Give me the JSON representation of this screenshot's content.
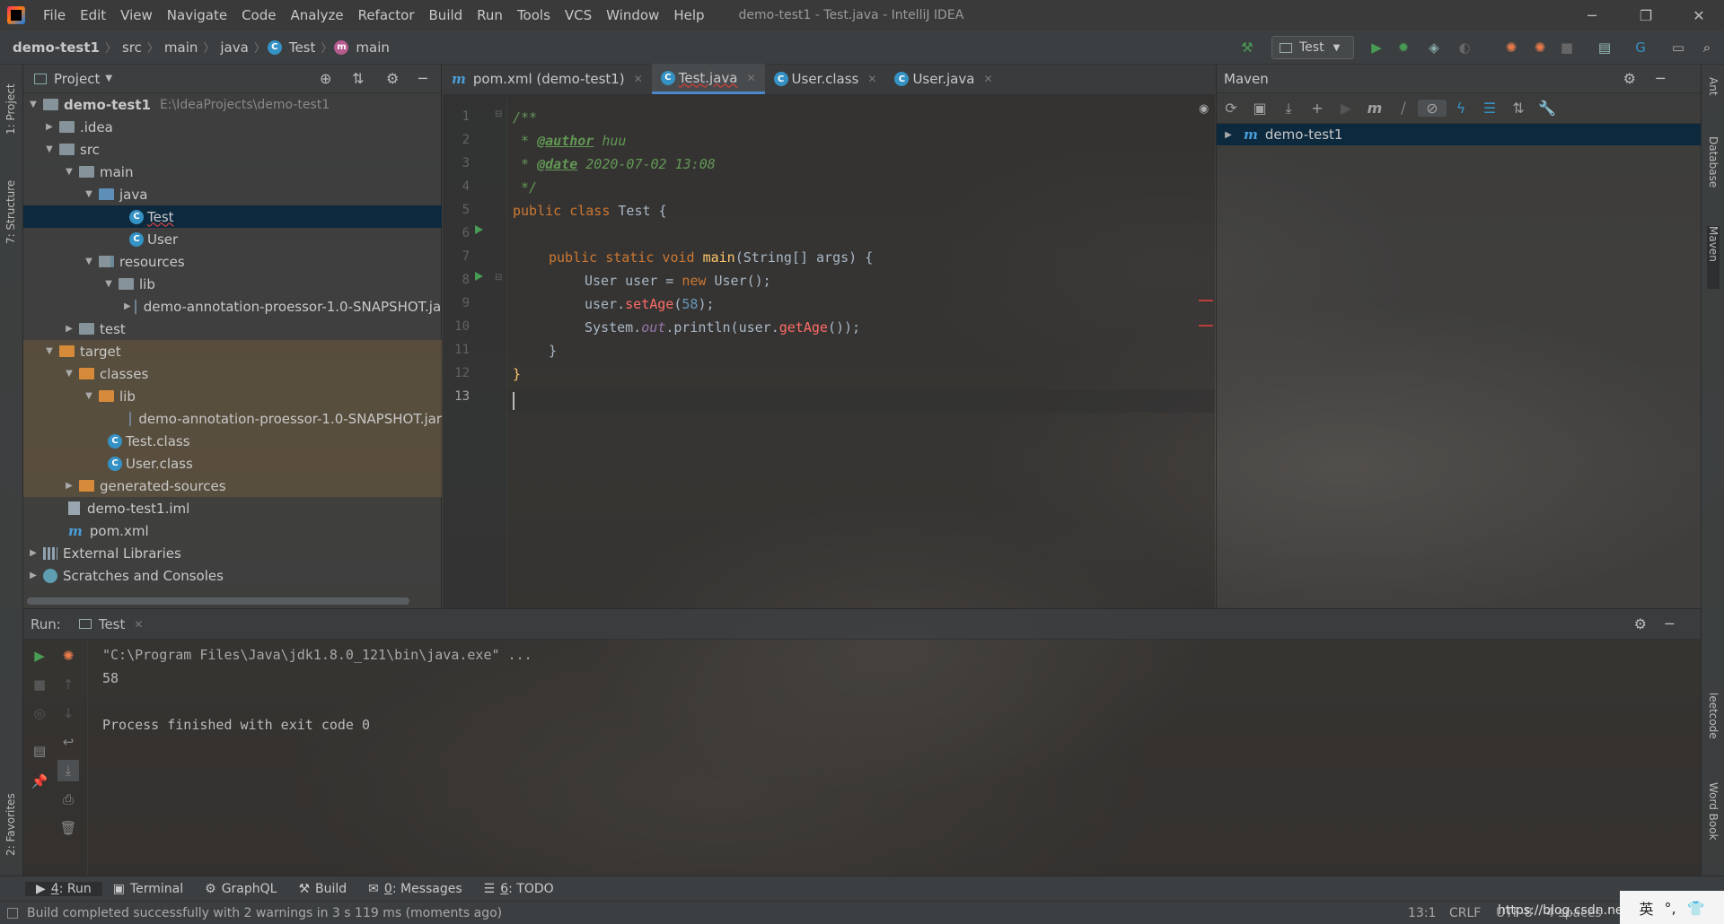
{
  "window": {
    "title": "demo-test1 - Test.java - IntelliJ IDEA",
    "controls": [
      "─",
      "❐",
      "✕"
    ]
  },
  "menu": [
    "File",
    "Edit",
    "View",
    "Navigate",
    "Code",
    "Analyze",
    "Refactor",
    "Build",
    "Run",
    "Tools",
    "VCS",
    "Window",
    "Help"
  ],
  "breadcrumb": {
    "project": "demo-test1",
    "items": [
      "src",
      "main",
      "java",
      "Test",
      "main"
    ]
  },
  "run_config": {
    "label": "Test"
  },
  "project_panel": {
    "title": "Project",
    "tree": [
      {
        "label": "demo-test1",
        "hint": "E:\\IdeaProjects\\demo-test1"
      },
      {
        "label": ".idea"
      },
      {
        "label": "src"
      },
      {
        "label": "main"
      },
      {
        "label": "java"
      },
      {
        "label": "Test"
      },
      {
        "label": "User"
      },
      {
        "label": "resources"
      },
      {
        "label": "lib"
      },
      {
        "label": "demo-annotation-proessor-1.0-SNAPSHOT.jar"
      },
      {
        "label": "test"
      },
      {
        "label": "target"
      },
      {
        "label": "classes"
      },
      {
        "label": "lib"
      },
      {
        "label": "demo-annotation-proessor-1.0-SNAPSHOT.jar"
      },
      {
        "label": "Test.class"
      },
      {
        "label": "User.class"
      },
      {
        "label": "generated-sources"
      },
      {
        "label": "demo-test1.iml"
      },
      {
        "label": "pom.xml"
      },
      {
        "label": "External Libraries"
      },
      {
        "label": "Scratches and Consoles"
      }
    ]
  },
  "editor": {
    "tabs": [
      {
        "label": "pom.xml (demo-test1)",
        "icon": "m"
      },
      {
        "label": "Test.java",
        "icon": "c"
      },
      {
        "label": "User.class",
        "icon": "c"
      },
      {
        "label": "User.java",
        "icon": "c"
      }
    ],
    "line_numbers": [
      "1",
      "2",
      "3",
      "4",
      "5",
      "6",
      "7",
      "8",
      "9",
      "10",
      "11",
      "12",
      "13"
    ],
    "code": {
      "l1": "/**",
      "l2_star": " * ",
      "l2_tag": "@author",
      "l2_val": " huu",
      "l3_star": " * ",
      "l3_tag": "@date",
      "l3_val": " 2020-07-02 13:08",
      "l4": " */",
      "l5_kw": "public class",
      "l5_rest": " Test {",
      "l7_kw": "public static void",
      "l7_fn": "main",
      "l7_rest": "(String[] args) {",
      "l8_a": "User user = ",
      "l8_kw": "new",
      "l8_b": " User();",
      "l9_a": "user.",
      "l9_err": "setAge",
      "l9_b": "(",
      "l9_num": "58",
      "l9_c": ");",
      "l10_a": "System.",
      "l10_ref": "out",
      "l10_b": ".println(user.",
      "l10_err": "getAge",
      "l10_c": "());",
      "l11": "}",
      "l12": "}"
    }
  },
  "maven_panel": {
    "title": "Maven",
    "root": "demo-test1"
  },
  "run_panel": {
    "label": "Run:",
    "tab": "Test",
    "console": [
      "\"C:\\Program Files\\Java\\jdk1.8.0_121\\bin\\java.exe\" ...",
      "58",
      "",
      "Process finished with exit code 0"
    ]
  },
  "left_strip": [
    "1: Project",
    "7: Structure",
    "2: Favorites"
  ],
  "right_strip": [
    "Ant",
    "Database",
    "Maven",
    "leetcode",
    "Word Book"
  ],
  "bottom_tools": [
    {
      "prefix": "4",
      "label": ": Run"
    },
    {
      "prefix": "",
      "label": "Terminal"
    },
    {
      "prefix": "",
      "label": "GraphQL"
    },
    {
      "prefix": "",
      "label": "Build"
    },
    {
      "prefix": "0",
      "label": ": Messages"
    },
    {
      "prefix": "6",
      "label": ": TODO"
    }
  ],
  "status": {
    "message": "Build completed successfully with 2 warnings in 3 s 119 ms (moments ago)",
    "position": "13:1",
    "line_sep": "CRLF",
    "encoding": "UTF-8",
    "indent": "4 spaces",
    "watermark": "https://blog.csdn.ne",
    "ime": "英"
  }
}
